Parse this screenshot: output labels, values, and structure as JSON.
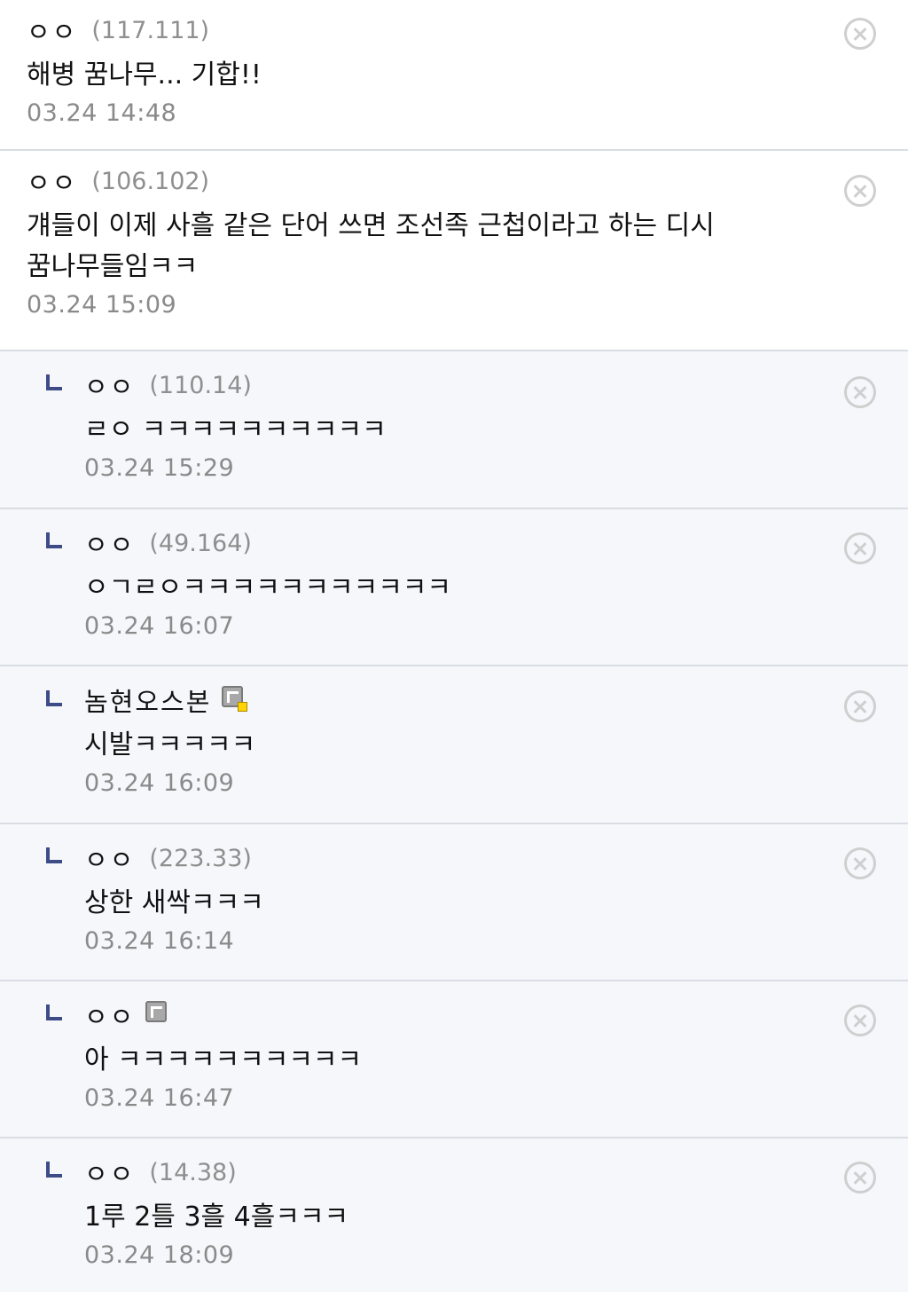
{
  "comments": [
    {
      "type": "top",
      "nickname": "ㅇㅇ",
      "ip": "(117.111)",
      "text": "해병 꿈나무... 기합!!",
      "date": "03.24 14:48"
    },
    {
      "type": "top",
      "nickname": "ㅇㅇ",
      "ip": "(106.102)",
      "text": "걔들이 이제 사흘 같은 단어 쓰면 조선족 근첩이라고 하는 디시 꿈나무들임ㅋㅋ",
      "date": "03.24 15:09"
    },
    {
      "type": "reply",
      "nickname": "ㅇㅇ",
      "ip": "(110.14)",
      "text": "ㄹㅇ ㅋㅋㅋㅋㅋㅋㅋㅋㅋㅋ",
      "date": "03.24 15:29"
    },
    {
      "type": "reply",
      "nickname": "ㅇㅇ",
      "ip": "(49.164)",
      "text": "ㅇㄱㄹㅇㅋㅋㅋㅋㅋㅋㅋㅋㅋㅋㅋ",
      "date": "03.24 16:07"
    },
    {
      "type": "reply",
      "nickname": "놈현오스본",
      "icon": "fixed-gallog-icon",
      "text": "시발ㅋㅋㅋㅋㅋ",
      "date": "03.24 16:09"
    },
    {
      "type": "reply",
      "nickname": "ㅇㅇ",
      "ip": "(223.33)",
      "text": "상한 새싹ㅋㅋㅋ",
      "date": "03.24 16:14"
    },
    {
      "type": "reply",
      "nickname": "ㅇㅇ",
      "icon": "gallog-icon",
      "text": "아 ㅋㅋㅋㅋㅋㅋㅋㅋㅋㅋ",
      "date": "03.24 16:47"
    },
    {
      "type": "reply",
      "nickname": "ㅇㅇ",
      "ip": "(14.38)",
      "text": "1루 2틀 3흘 4흘ㅋㅋㅋ",
      "date": "03.24 18:09"
    }
  ],
  "colors": {
    "reply_background": "#f6f7fa",
    "reply_marker": "#3d4b87",
    "divider": "#d9dde4",
    "meta_text": "#8f8f8f"
  }
}
